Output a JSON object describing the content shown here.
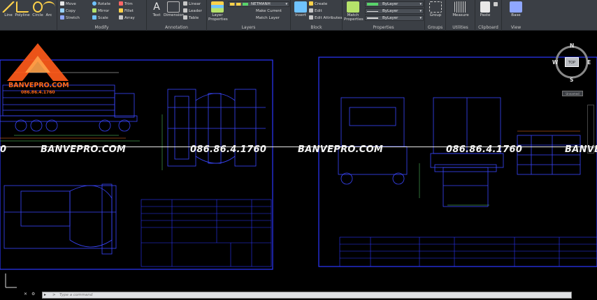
{
  "ribbon": {
    "draw": {
      "line": "Line",
      "polyline": "Polyline",
      "circle": "Circle",
      "arc": "Arc"
    },
    "modify": {
      "title": "Modify",
      "move": "Move",
      "rotate": "Rotate",
      "trim": "Trim",
      "copy": "Copy",
      "mirror": "Mirror",
      "fillet": "Fillet",
      "stretch": "Stretch",
      "scale": "Scale",
      "array": "Array"
    },
    "annotation": {
      "title": "Annotation",
      "text": "Text",
      "dimension": "Dimension",
      "linear": "Linear",
      "leader": "Leader",
      "table": "Table"
    },
    "layers": {
      "title": "Layers",
      "layer_properties": "Layer Properties",
      "current_layer": "NETMANH",
      "make_current": "Make Current",
      "match_layer": "Match Layer"
    },
    "block": {
      "title": "Block",
      "insert": "Insert",
      "create": "Create",
      "edit": "Edit",
      "edit_attributes": "Edit Attributes"
    },
    "properties": {
      "title": "Properties",
      "match_properties": "Match Properties",
      "color": "ByLayer",
      "linetype": "ByLayer",
      "lineweight": "ByLayer"
    },
    "groups": {
      "title": "Groups",
      "group": "Group"
    },
    "utilities": {
      "title": "Utilities",
      "measure": "Measure"
    },
    "clipboard": {
      "title": "Clipboard",
      "paste": "Paste"
    },
    "view": {
      "title": "View",
      "base": "Base"
    }
  },
  "branding": {
    "name": "BANVEPRO.COM",
    "phone": "086.86.4.1760"
  },
  "watermark": {
    "items": [
      "0",
      "BANVEPRO.COM",
      "086.86.4.1760",
      "BANVEPRO.COM",
      "086.86.4.1760",
      "BANVE"
    ]
  },
  "viewcube": {
    "n": "N",
    "s": "S",
    "e": "E",
    "w": "W",
    "face": "TOP",
    "wcs": "Unnamed"
  },
  "command": {
    "placeholder": "Type a command"
  },
  "colors": {
    "accent": "#2c37ff",
    "background": "#000000",
    "watermark_brand": "#ff6a1a"
  }
}
